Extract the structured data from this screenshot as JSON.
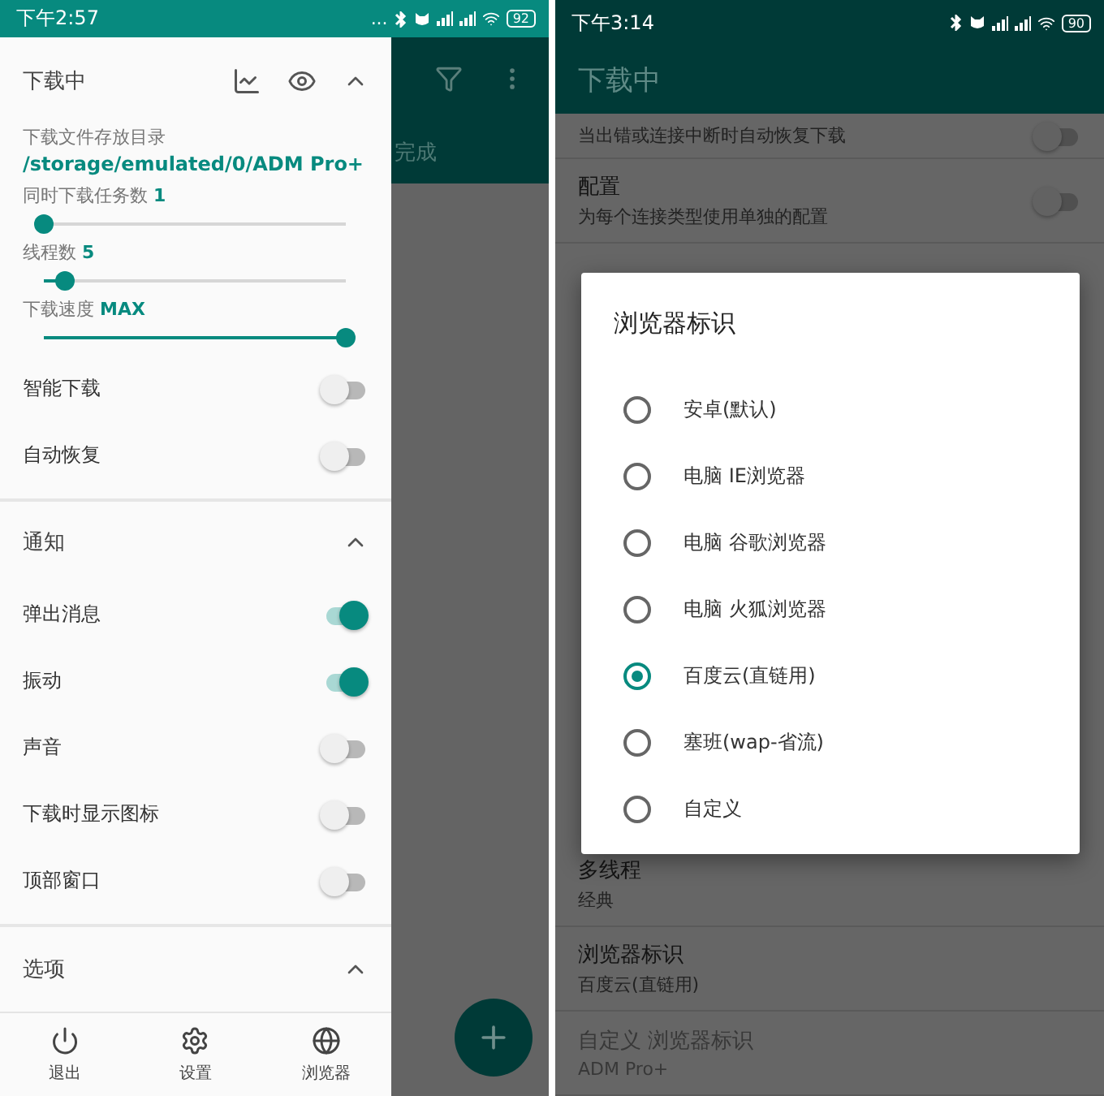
{
  "left_screen": {
    "status_bar": {
      "time": "下午2:57",
      "more": "...",
      "battery": "92"
    },
    "app_bar": {
      "tab_label": "完成"
    },
    "drawer": {
      "title": "下载中",
      "download_dir_label": "下载文件存放目录",
      "download_dir": "/storage/emulated/0/ADM Pro+",
      "sliders": [
        {
          "label": "同时下载任务数",
          "value": "1",
          "level": 0
        },
        {
          "label": "线程数",
          "value": "5",
          "level": 0.07
        },
        {
          "label": "下载速度",
          "value": "MAX",
          "level": 1
        }
      ],
      "toggles": [
        {
          "label": "智能下载",
          "on": false
        },
        {
          "label": "自动恢复",
          "on": false
        }
      ],
      "sections": [
        {
          "title": "通知",
          "expanded": true,
          "toggles": [
            {
              "label": "弹出消息",
              "on": true
            },
            {
              "label": "振动",
              "on": true
            },
            {
              "label": "声音",
              "on": false
            },
            {
              "label": "下载时显示图标",
              "on": false
            },
            {
              "label": "顶部窗口",
              "on": false
            }
          ]
        },
        {
          "title": "选项",
          "expanded": true
        }
      ]
    },
    "bottom_nav": [
      {
        "label": "退出"
      },
      {
        "label": "设置"
      },
      {
        "label": "浏览器"
      }
    ]
  },
  "right_screen": {
    "status_bar": {
      "time": "下午3:14",
      "battery": "90"
    },
    "app_bar": {
      "title": "下载中"
    },
    "top_settings": [
      {
        "subtitle": "当出错或连接中断时自动恢复下载",
        "on": false
      },
      {
        "title": "配置",
        "subtitle": "为每个连接类型使用单独的配置",
        "on": false
      }
    ],
    "bottom_settings": [
      {
        "title": "多线程",
        "subtitle": "经典",
        "disabled": false
      },
      {
        "title": "浏览器标识",
        "subtitle": "百度云(直链用)",
        "disabled": false
      },
      {
        "title": "自定义 浏览器标识",
        "subtitle": "ADM Pro+",
        "disabled": true
      }
    ],
    "dialog": {
      "title": "浏览器标识",
      "options": [
        {
          "label": "安卓(默认)",
          "selected": false
        },
        {
          "label": "电脑 IE浏览器",
          "selected": false
        },
        {
          "label": "电脑 谷歌浏览器",
          "selected": false
        },
        {
          "label": "电脑 火狐浏览器",
          "selected": false
        },
        {
          "label": "百度云(直链用)",
          "selected": true
        },
        {
          "label": "塞班(wap-省流)",
          "selected": false
        },
        {
          "label": "自定义",
          "selected": false
        }
      ]
    }
  }
}
